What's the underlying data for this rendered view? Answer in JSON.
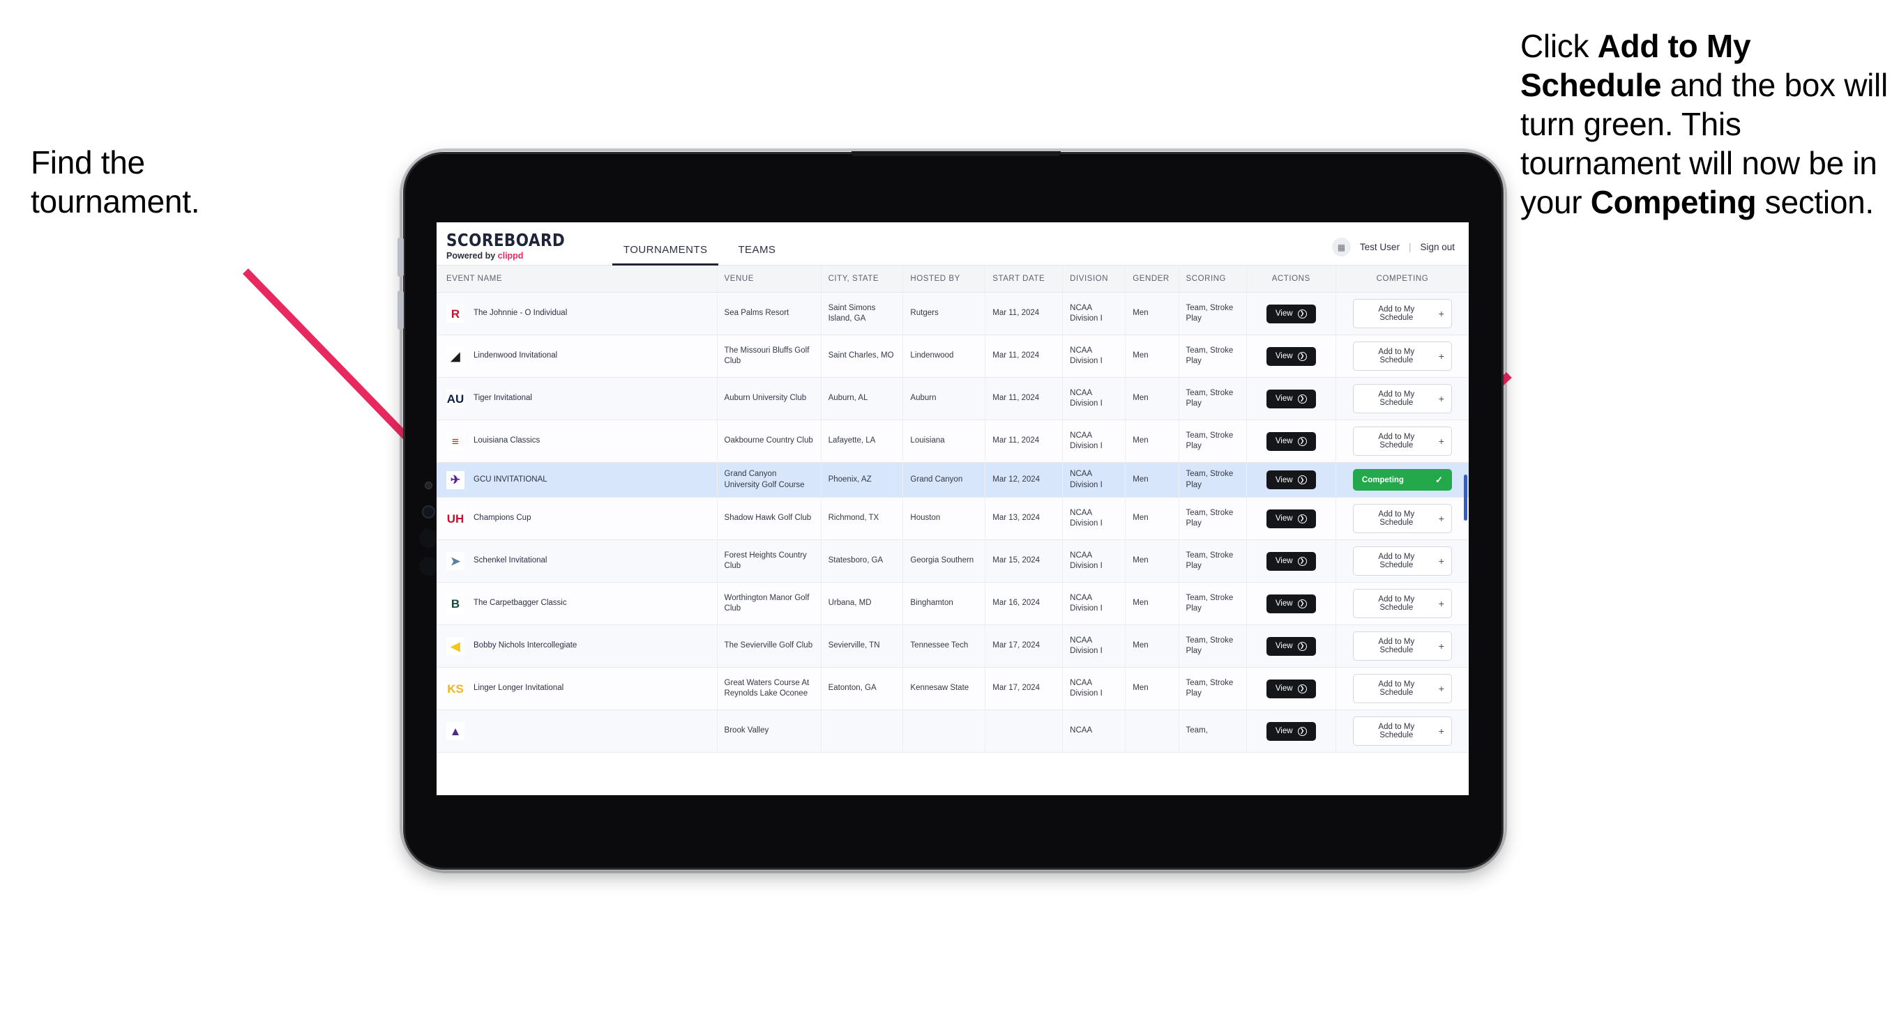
{
  "annotations": {
    "left": {
      "line1": "Find the",
      "line2": "tournament."
    },
    "right": {
      "p1": "Click ",
      "b1": "Add to My Schedule",
      "p2": " and the box will turn green. This tournament will now be in your ",
      "b2": "Competing",
      "p3": " section."
    },
    "arrow_color": "#e8295f"
  },
  "app": {
    "brand": {
      "title": "SCOREBOARD",
      "powered_prefix": "Powered by ",
      "powered_name": "clippd"
    },
    "tabs": [
      {
        "label": "TOURNAMENTS",
        "active": true
      },
      {
        "label": "TEAMS",
        "active": false
      }
    ],
    "user": {
      "avatar_icon": "user-avatar-icon",
      "name": "Test User",
      "separator": "|",
      "signout": "Sign out"
    }
  },
  "table": {
    "columns": [
      "EVENT NAME",
      "VENUE",
      "CITY, STATE",
      "HOSTED BY",
      "START DATE",
      "DIVISION",
      "GENDER",
      "SCORING",
      "ACTIONS",
      "COMPETING"
    ],
    "buttons": {
      "view": "View",
      "view_icon": "arrow-right-circle-icon",
      "add": "Add to My Schedule",
      "add_icon": "plus-icon",
      "competing": "Competing",
      "competing_icon": "check-icon"
    },
    "rows": [
      {
        "logo_text": "R",
        "logo_bg": "#ffffff",
        "logo_fg": "#c8102e",
        "event": "The Johnnie - O Individual",
        "venue": "Sea Palms Resort",
        "city": "Saint Simons Island, GA",
        "host": "Rutgers",
        "date": "Mar 11, 2024",
        "division": "NCAA Division I",
        "gender": "Men",
        "scoring": "Team, Stroke Play",
        "competing": false
      },
      {
        "logo_text": "◢",
        "logo_bg": "#ffffff",
        "logo_fg": "#1b1b1b",
        "event": "Lindenwood Invitational",
        "venue": "The Missouri Bluffs Golf Club",
        "city": "Saint Charles, MO",
        "host": "Lindenwood",
        "date": "Mar 11, 2024",
        "division": "NCAA Division I",
        "gender": "Men",
        "scoring": "Team, Stroke Play",
        "competing": false
      },
      {
        "logo_text": "AU",
        "logo_bg": "#ffffff",
        "logo_fg": "#0c2340",
        "event": "Tiger Invitational",
        "venue": "Auburn University Club",
        "city": "Auburn, AL",
        "host": "Auburn",
        "date": "Mar 11, 2024",
        "division": "NCAA Division I",
        "gender": "Men",
        "scoring": "Team, Stroke Play",
        "competing": false
      },
      {
        "logo_text": "≡",
        "logo_bg": "#ffffff",
        "logo_fg": "#ce2030",
        "event": "Louisiana Classics",
        "venue": "Oakbourne Country Club",
        "city": "Lafayette, LA",
        "host": "Louisiana",
        "date": "Mar 11, 2024",
        "division": "NCAA Division I",
        "gender": "Men",
        "scoring": "Team, Stroke Play",
        "competing": false
      },
      {
        "logo_text": "✈",
        "logo_bg": "#ffffff",
        "logo_fg": "#522398",
        "event": "GCU INVITATIONAL",
        "venue": "Grand Canyon University Golf Course",
        "city": "Phoenix, AZ",
        "host": "Grand Canyon",
        "date": "Mar 12, 2024",
        "division": "NCAA Division I",
        "gender": "Men",
        "scoring": "Team, Stroke Play",
        "competing": true
      },
      {
        "logo_text": "UH",
        "logo_bg": "#ffffff",
        "logo_fg": "#c8102e",
        "event": "Champions Cup",
        "venue": "Shadow Hawk Golf Club",
        "city": "Richmond, TX",
        "host": "Houston",
        "date": "Mar 13, 2024",
        "division": "NCAA Division I",
        "gender": "Men",
        "scoring": "Team, Stroke Play",
        "competing": false
      },
      {
        "logo_text": "➤",
        "logo_bg": "#ffffff",
        "logo_fg": "#5b7f9e",
        "event": "Schenkel Invitational",
        "venue": "Forest Heights Country Club",
        "city": "Statesboro, GA",
        "host": "Georgia Southern",
        "date": "Mar 15, 2024",
        "division": "NCAA Division I",
        "gender": "Men",
        "scoring": "Team, Stroke Play",
        "competing": false
      },
      {
        "logo_text": "B",
        "logo_bg": "#ffffff",
        "logo_fg": "#17473f",
        "event": "The Carpetbagger Classic",
        "venue": "Worthington Manor Golf Club",
        "city": "Urbana, MD",
        "host": "Binghamton",
        "date": "Mar 16, 2024",
        "division": "NCAA Division I",
        "gender": "Men",
        "scoring": "Team, Stroke Play",
        "competing": false
      },
      {
        "logo_text": "◀",
        "logo_bg": "#ffffff",
        "logo_fg": "#f5c518",
        "event": "Bobby Nichols Intercollegiate",
        "venue": "The Sevierville Golf Club",
        "city": "Sevierville, TN",
        "host": "Tennessee Tech",
        "date": "Mar 17, 2024",
        "division": "NCAA Division I",
        "gender": "Men",
        "scoring": "Team, Stroke Play",
        "competing": false
      },
      {
        "logo_text": "KS",
        "logo_bg": "#ffffff",
        "logo_fg": "#f0b323",
        "event": "Linger Longer Invitational",
        "venue": "Great Waters Course At Reynolds Lake Oconee",
        "city": "Eatonton, GA",
        "host": "Kennesaw State",
        "date": "Mar 17, 2024",
        "division": "NCAA Division I",
        "gender": "Men",
        "scoring": "Team, Stroke Play",
        "competing": false
      },
      {
        "logo_text": "▲",
        "logo_bg": "#ffffff",
        "logo_fg": "#4b2e83",
        "event": "",
        "venue": "Brook Valley",
        "city": "",
        "host": "",
        "date": "",
        "division": "NCAA",
        "gender": "",
        "scoring": "Team,",
        "competing": false
      }
    ]
  }
}
